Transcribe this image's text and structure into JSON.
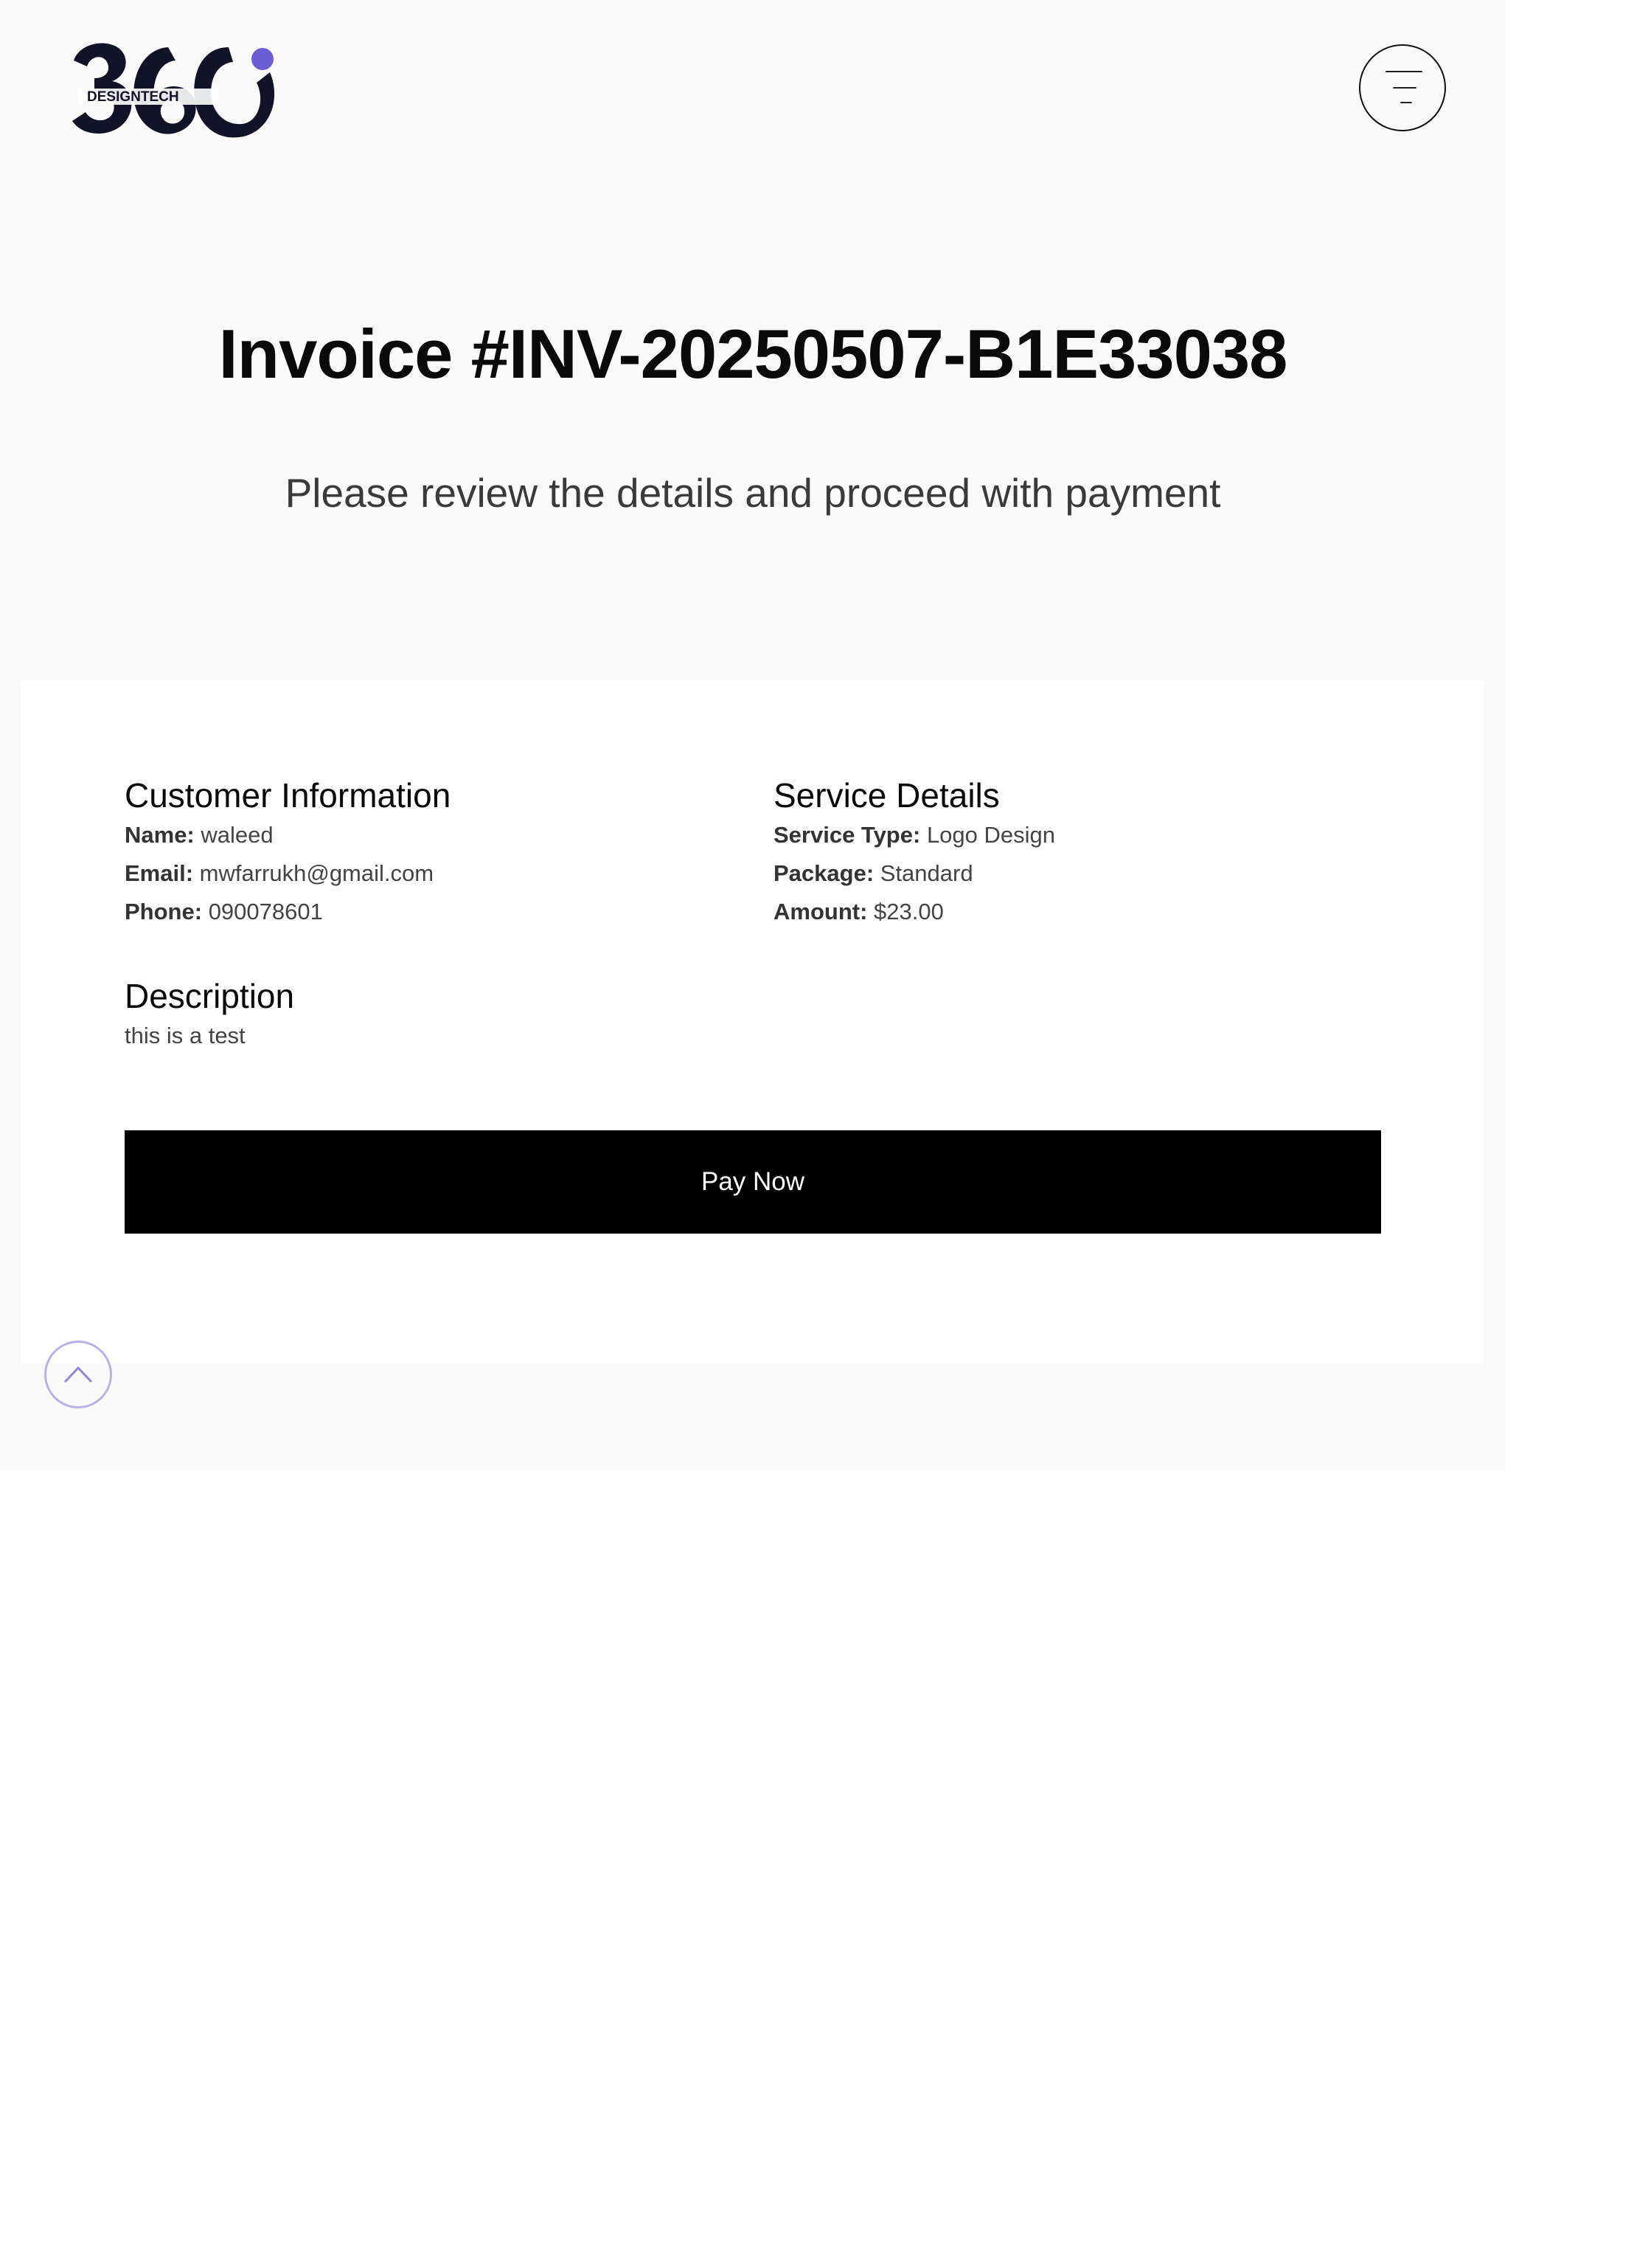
{
  "header": {
    "logo": {
      "text_main": "360",
      "text_sub": "DESIGNTECH",
      "accent_color": "#6b5fd6"
    },
    "menu_icon": "filter-lines-icon"
  },
  "invoice": {
    "title": "Invoice #INV-20250507-B1E33038",
    "subtitle": "Please review the details and proceed with payment"
  },
  "customer": {
    "heading": "Customer Information",
    "name_label": "Name:",
    "name_value": "waleed",
    "email_label": "Email:",
    "email_value": "mwfarrukh@gmail.com",
    "phone_label": "Phone:",
    "phone_value": "090078601"
  },
  "service": {
    "heading": "Service Details",
    "type_label": "Service Type:",
    "type_value": "Logo Design",
    "package_label": "Package:",
    "package_value": "Standard",
    "amount_label": "Amount:",
    "amount_value": "$23.00"
  },
  "description": {
    "heading": "Description",
    "text": "this is a test"
  },
  "actions": {
    "pay_label": "Pay Now",
    "scroll_top_icon": "chevron-up-icon",
    "scroll_top_color": "#b8b2ea"
  }
}
